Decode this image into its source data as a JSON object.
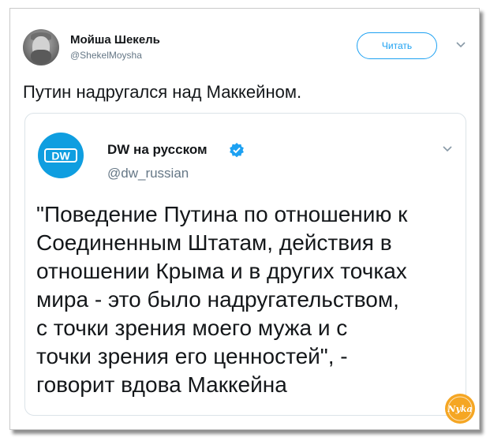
{
  "tweet": {
    "author_name": "Мойша Шекель",
    "author_handle": "@ShekelMoysha",
    "follow_label": "Читать",
    "text": "Путин надругался над Маккейном."
  },
  "quoted": {
    "logo_text": "DW",
    "author_name": "DW на русском",
    "author_handle": "@dw_russian",
    "text": "\"Поведение Путина по отношению к\nСоединенным Штатам, действия в\nотношении Крыма и в других точках\nмира - это было надругательством,\nс точки зрения моего мужа и с\nточки зрения его ценностей\", -\nговорит вдова Маккейна"
  },
  "watermark": {
    "text": "Nyka"
  },
  "colors": {
    "accent": "#1da1f2",
    "dw_blue": "#0f9ee0",
    "text": "#14171a",
    "muted": "#657786",
    "watermark": "#f5a623"
  },
  "icons": [
    "avatar-photo",
    "chevron-down-icon",
    "dw-logo-icon",
    "verified-badge-icon",
    "watermark-logo"
  ]
}
